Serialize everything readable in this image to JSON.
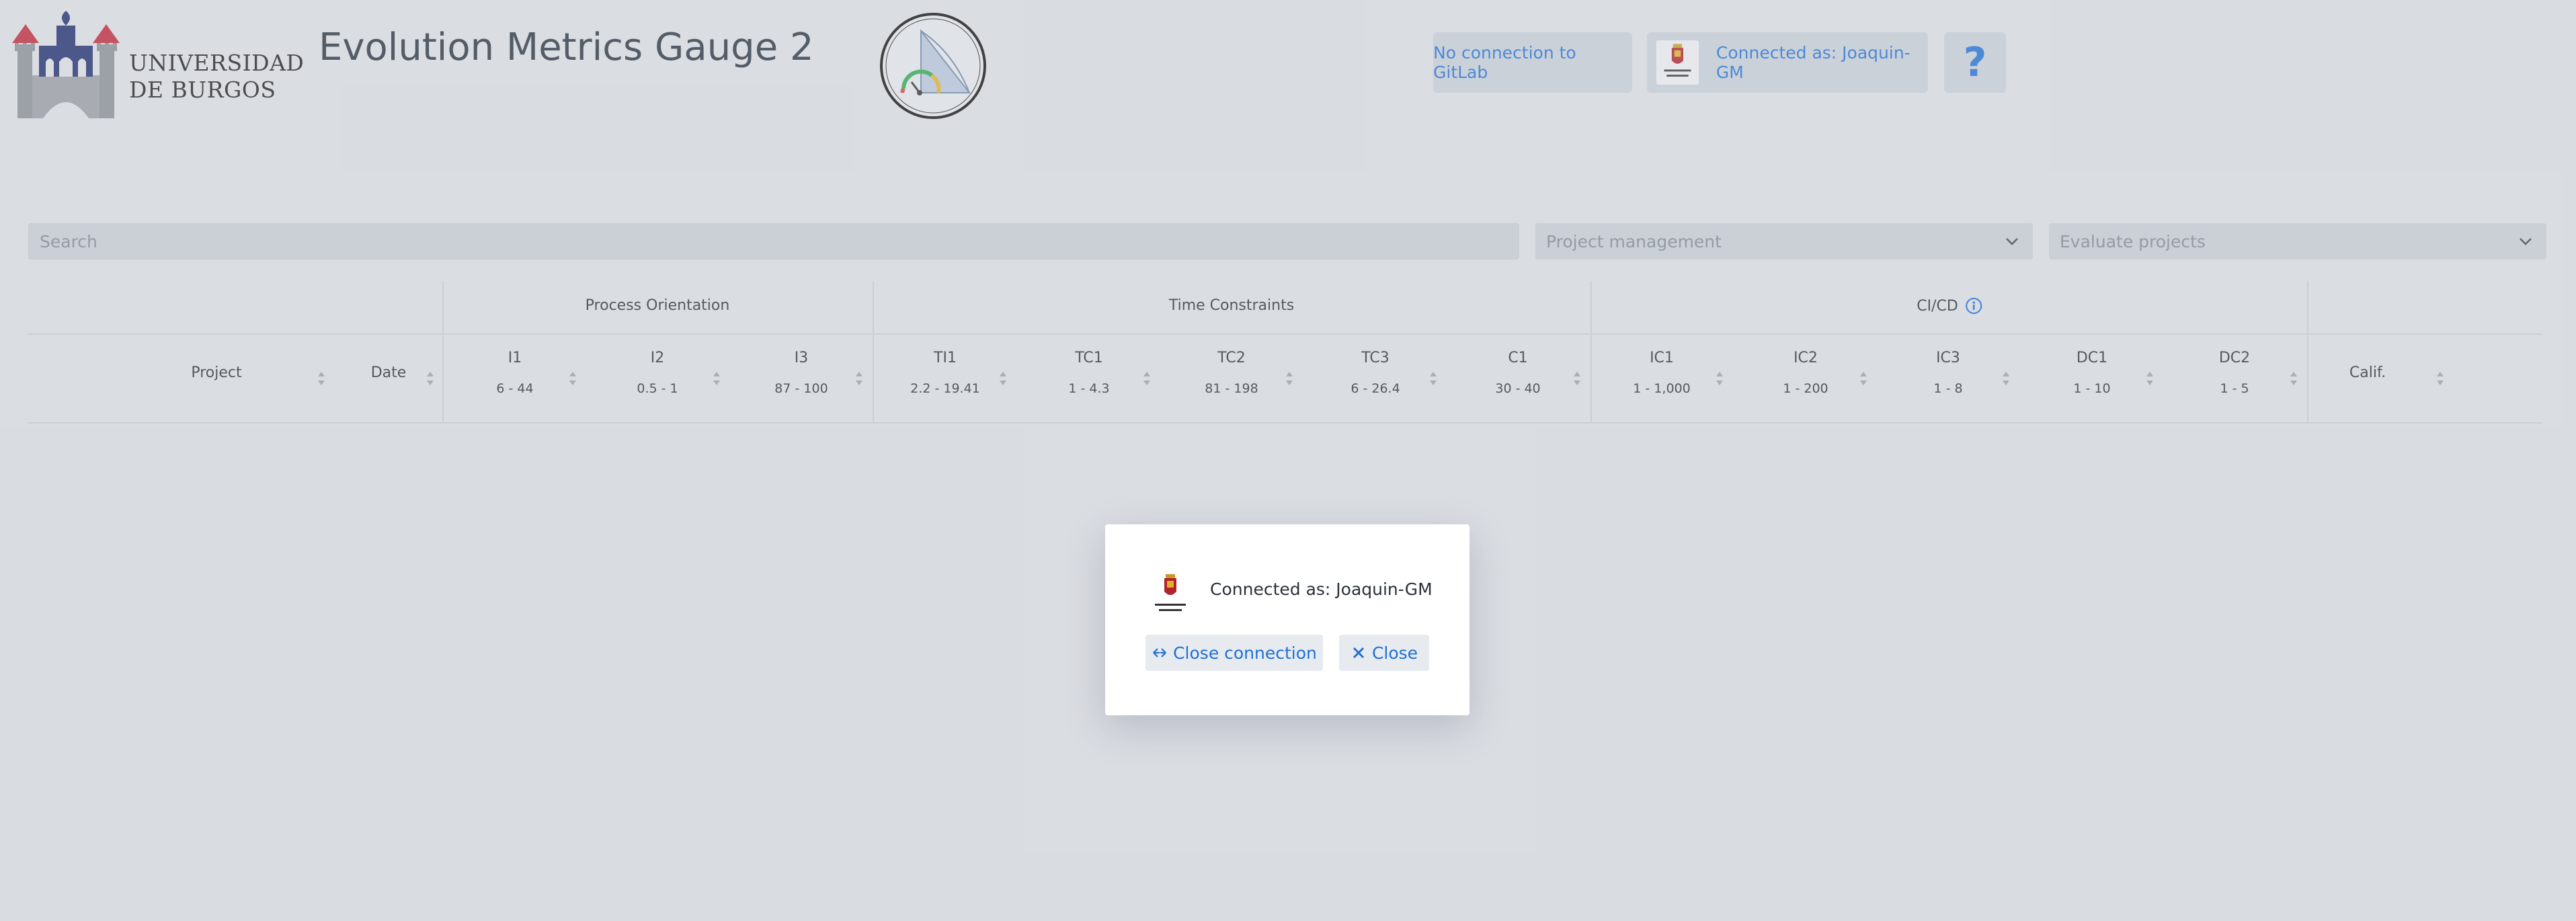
{
  "header": {
    "university_line1": "UNIVERSIDAD",
    "university_line2": "DE BURGOS",
    "app_title": "Evolution Metrics Gauge 2",
    "gitlab_status": "No connection to GitLab",
    "connected_as": "Connected as: Joaquin-GM",
    "help_label": "?"
  },
  "filters": {
    "search_placeholder": "Search",
    "project_management": "Project management",
    "evaluate_projects": "Evaluate projects"
  },
  "table": {
    "groups": [
      "Process Orientation",
      "Time Constraints",
      "CI/CD"
    ],
    "columns": [
      {
        "name": "Project"
      },
      {
        "name": "Date"
      },
      {
        "name": "I1",
        "range": "6 - 44"
      },
      {
        "name": "I2",
        "range": "0.5 - 1"
      },
      {
        "name": "I3",
        "range": "87 - 100"
      },
      {
        "name": "TI1",
        "range": "2.2 - 19.41"
      },
      {
        "name": "TC1",
        "range": "1 - 4.3"
      },
      {
        "name": "TC2",
        "range": "81 - 198"
      },
      {
        "name": "TC3",
        "range": "6 - 26.4"
      },
      {
        "name": "C1",
        "range": "30 - 40"
      },
      {
        "name": "IC1",
        "range": "1 - 1,000"
      },
      {
        "name": "IC2",
        "range": "1 - 200"
      },
      {
        "name": "IC3",
        "range": "1 - 8"
      },
      {
        "name": "DC1",
        "range": "1 - 10"
      },
      {
        "name": "DC2",
        "range": "1 - 5"
      },
      {
        "name": "Calif."
      }
    ]
  },
  "modal": {
    "connected_as": "Connected as: Joaquin-GM",
    "close_connection": "Close connection",
    "close": "Close"
  },
  "colors": {
    "background": "#dcdfe4",
    "accent": "#1f6fd6"
  }
}
